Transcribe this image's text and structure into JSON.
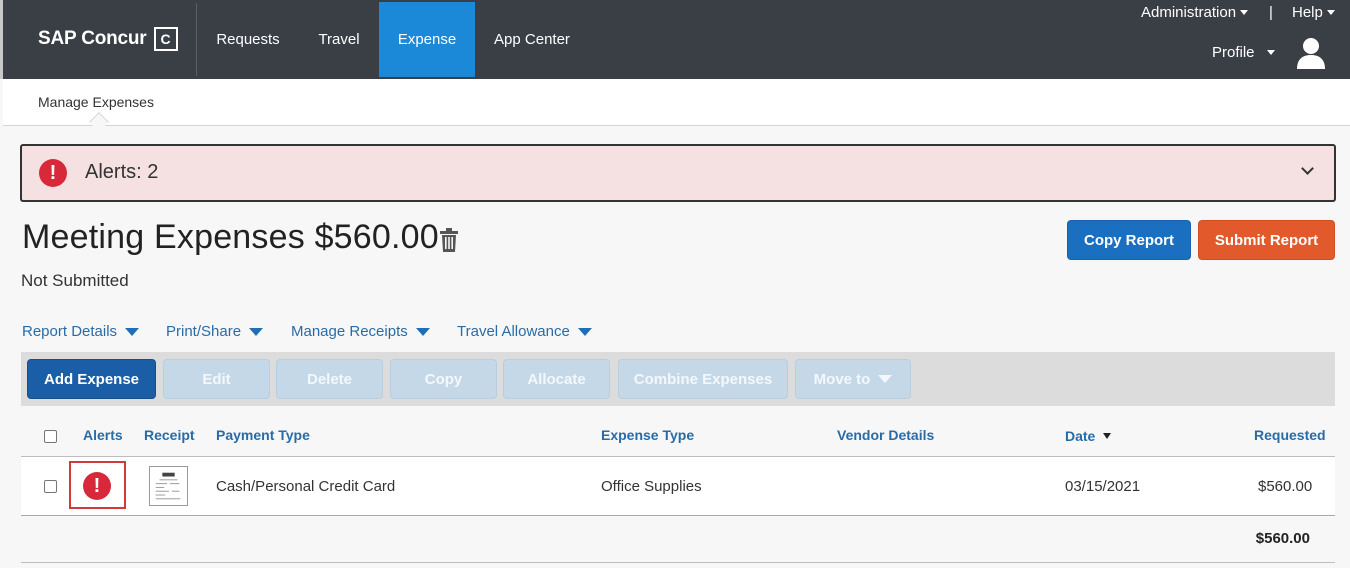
{
  "nav": {
    "logo_text": "SAP Concur",
    "logo_mark": "C",
    "items": [
      {
        "label": "Requests",
        "active": false
      },
      {
        "label": "Travel",
        "active": false
      },
      {
        "label": "Expense",
        "active": true
      },
      {
        "label": "App Center",
        "active": false
      }
    ],
    "administration": "Administration",
    "separator": "|",
    "help": "Help",
    "profile": "Profile"
  },
  "subnav": {
    "label": "Manage Expenses"
  },
  "alert": {
    "text": "Alerts: 2",
    "icon": "exclamation-circle-icon",
    "color": "#d7293a"
  },
  "report": {
    "title": "Meeting Expenses $560.00",
    "status": "Not Submitted",
    "copy_button": "Copy Report",
    "submit_button": "Submit Report"
  },
  "menus": [
    "Report Details",
    "Print/Share",
    "Manage Receipts",
    "Travel Allowance"
  ],
  "toolbar": {
    "add": "Add Expense",
    "edit": "Edit",
    "delete": "Delete",
    "copy": "Copy",
    "allocate": "Allocate",
    "combine": "Combine Expenses",
    "move_to": "Move to"
  },
  "table": {
    "headers": {
      "alerts": "Alerts",
      "receipt": "Receipt",
      "payment_type": "Payment Type",
      "expense_type": "Expense Type",
      "vendor_details": "Vendor Details",
      "date": "Date",
      "requested": "Requested"
    },
    "rows": [
      {
        "payment_type": "Cash/Personal Credit Card",
        "expense_type": "Office Supplies",
        "vendor_details": "",
        "date": "03/15/2021",
        "requested": "$560.00"
      }
    ],
    "total": "$560.00"
  },
  "colors": {
    "nav_bg": "#3a3e45",
    "nav_active": "#1b88d8",
    "primary_blue": "#1b6fc0",
    "submit_orange": "#e2592c",
    "alert_bg": "#f5e1e1"
  }
}
